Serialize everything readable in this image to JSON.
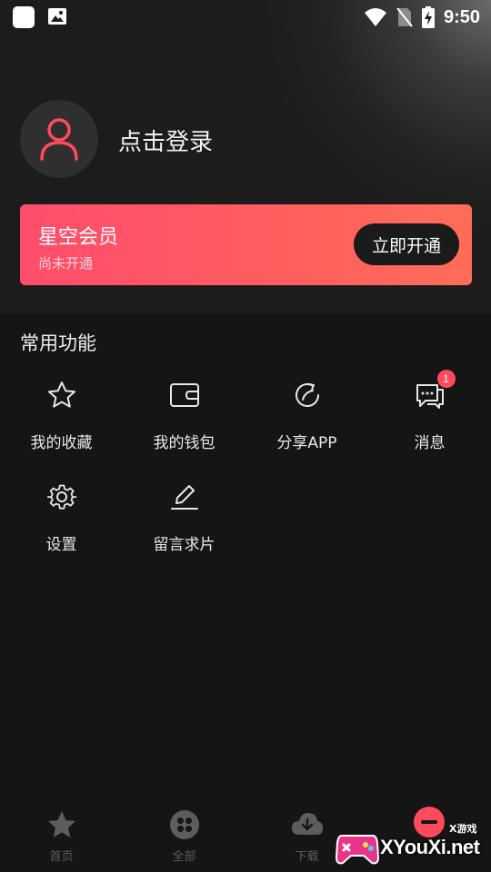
{
  "status_bar": {
    "time": "9:50"
  },
  "profile": {
    "login_text": "点击登录"
  },
  "vip": {
    "title": "星空会员",
    "subtitle": "尚未开通",
    "button_label": "立即开通"
  },
  "section": {
    "title": "常用功能"
  },
  "functions": [
    {
      "label": "我的收藏",
      "icon": "star-icon"
    },
    {
      "label": "我的钱包",
      "icon": "wallet-icon"
    },
    {
      "label": "分享APP",
      "icon": "share-icon"
    },
    {
      "label": "消息",
      "icon": "message-icon",
      "badge": "1"
    },
    {
      "label": "设置",
      "icon": "gear-icon"
    },
    {
      "label": "留言求片",
      "icon": "edit-icon"
    }
  ],
  "bottom_nav": [
    {
      "label": "首页",
      "icon": "star-icon"
    },
    {
      "label": "全部",
      "icon": "grid-icon"
    },
    {
      "label": "下载",
      "icon": "cloud-download-icon"
    },
    {
      "label": "",
      "icon": "profile-icon"
    }
  ],
  "watermark": {
    "text": "XYouXi.net",
    "small": "X游戏"
  },
  "colors": {
    "accent": "#ff4a5c",
    "background": "#151515",
    "vip_gradient_start": "#ff4d6d",
    "vip_gradient_end": "#ff6d58"
  }
}
